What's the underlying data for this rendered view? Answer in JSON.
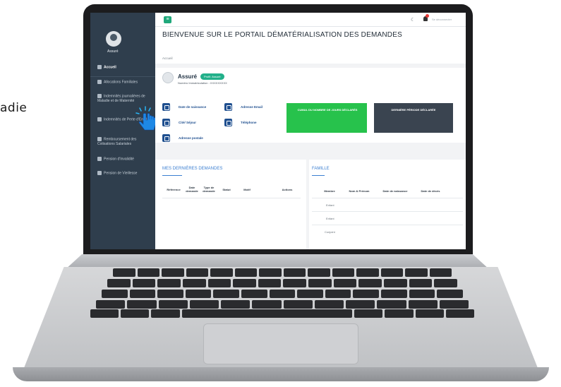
{
  "outside_text": "adie",
  "sidebar": {
    "user_label": "Assuré",
    "items": [
      {
        "label": "Accueil"
      },
      {
        "label": "Allocations Familiales"
      },
      {
        "label": "Indemnités journalières de Maladie et de Maternité"
      },
      {
        "label": "Indemnités de Perte d'Emploi"
      },
      {
        "label": "Remboursement des Cotisations Salariales"
      },
      {
        "label": "Pension d'Invalidité"
      },
      {
        "label": "Pension de Vieillesse"
      }
    ]
  },
  "topbar": {
    "menu_icon": "menu-icon",
    "logout_label": "Se déconnecter"
  },
  "header": {
    "title": "BIENVENUE SUR LE PORTAIL DÉMATÉRIALISATION DES DEMANDES",
    "breadcrumb": "Accueil"
  },
  "profile": {
    "name": "Assuré",
    "badge": "Profil: Assuré",
    "immat": "Numéro Immatriculation : XXXXXXXXX",
    "fields": [
      {
        "label": "Date de naissance",
        "icon": "calendar-icon"
      },
      {
        "label": "Adresse Email",
        "icon": "globe-icon"
      },
      {
        "label": "Cité/ Séjour",
        "icon": "id-card-icon"
      },
      {
        "label": "Téléphone",
        "icon": "phone-icon"
      },
      {
        "label": "Adresse postale",
        "icon": "home-icon"
      }
    ],
    "stat_green": "CUMUL DU NOMBRE DE JOURS DÉCLARÉS",
    "stat_dark": "DERNIÈRE PÉRIODE DÉCLARÉE"
  },
  "demandes": {
    "title": "MES DERNIÈRES DEMANDES",
    "columns": [
      "Référence",
      "Date demande",
      "Type de demande",
      "Statut",
      "Motif",
      "Actions"
    ]
  },
  "famille": {
    "title": "FAMILLE",
    "columns": [
      "Membre",
      "Nom & Prénom",
      "Date de naissance",
      "Date de décès"
    ],
    "rows": [
      "Enfant",
      "Enfant",
      "Conjoint"
    ]
  },
  "colors": {
    "sidebar": "#2f3e4d",
    "accent": "#1fa87b",
    "title_link": "#3b7fd1",
    "stat_green": "#27c24c",
    "stat_dark": "#3a4450"
  }
}
